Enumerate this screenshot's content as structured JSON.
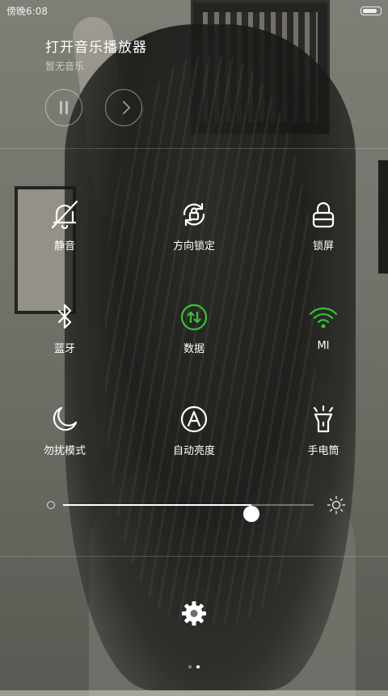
{
  "status_bar": {
    "time": "傍晚6:08",
    "battery_level": 0.9
  },
  "player": {
    "title": "打开音乐播放器",
    "subtitle": "暂无音乐",
    "controls": {
      "pause_icon": "pause-icon",
      "next_icon": "next-icon"
    }
  },
  "toggles": [
    {
      "label": "静音",
      "icon": "bell-off-icon",
      "active": false
    },
    {
      "label": "方向锁定",
      "icon": "rotation-lock-icon",
      "active": false
    },
    {
      "label": "锁屏",
      "icon": "lock-icon",
      "active": false
    },
    {
      "label": "蓝牙",
      "icon": "bluetooth-icon",
      "active": false
    },
    {
      "label": "数据",
      "icon": "mobile-data-icon",
      "active": true
    },
    {
      "label": "MI",
      "icon": "wifi-icon",
      "active": true
    },
    {
      "label": "勿扰模式",
      "icon": "moon-icon",
      "active": false
    },
    {
      "label": "自动亮度",
      "icon": "auto-brightness-icon",
      "active": false
    },
    {
      "label": "手电筒",
      "icon": "flashlight-icon",
      "active": false
    }
  ],
  "brightness": {
    "level": 0.75
  },
  "settings": {
    "icon": "gear-icon"
  },
  "pager": {
    "pages": 2,
    "current": 2
  },
  "colors": {
    "active": "#35c52f",
    "inactive": "#ffffff"
  }
}
